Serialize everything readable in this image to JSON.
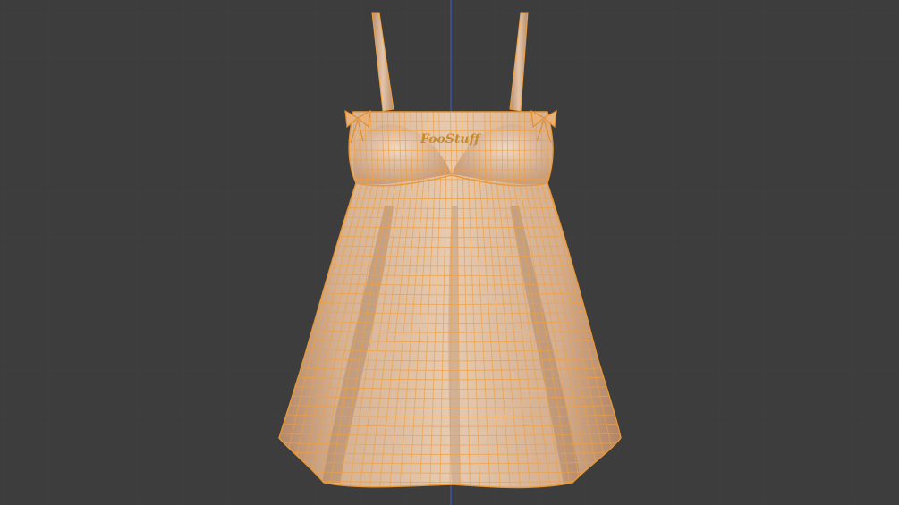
{
  "viewport": {
    "background": "#3d3d3d",
    "grid_line_color": "#454545",
    "axis_z_color": "#3a5ed6"
  },
  "model": {
    "object": "dress-mesh",
    "surface_color": "#d8b596",
    "shade_color": "#b88c6c",
    "highlight_color": "#ecd2ba",
    "wire_color": "#f0a040",
    "logo_text": "FooStuff"
  }
}
